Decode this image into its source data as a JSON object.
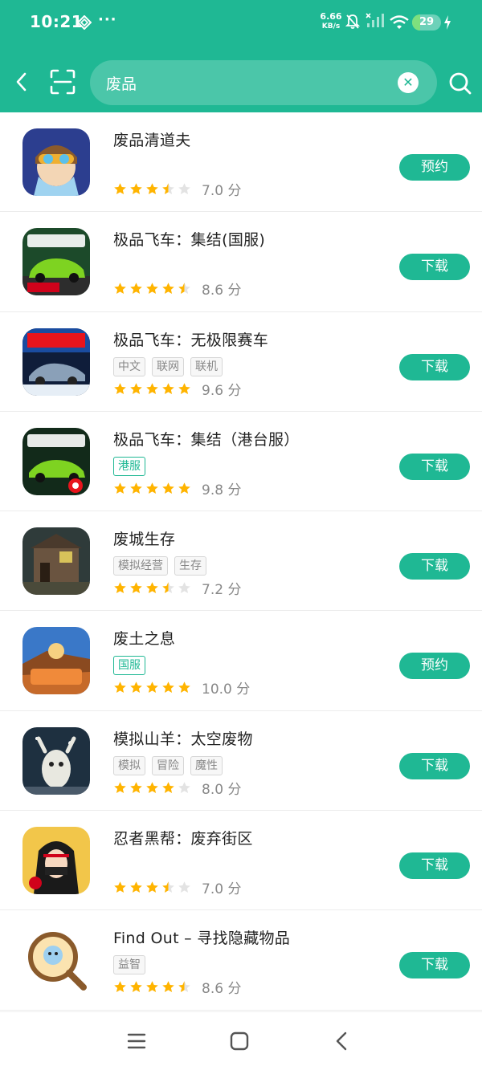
{
  "status_bar": {
    "time": "10:21",
    "dots": "···",
    "net_speed_value": "6.66",
    "net_speed_unit": "KB/s",
    "battery_level": "29",
    "battery_fraction": 0.29,
    "icons": [
      "diamond-app-icon",
      "mute-icon",
      "signal-icon",
      "wifi-icon",
      "battery-icon",
      "charging-icon"
    ]
  },
  "search": {
    "query": "废品",
    "icons": [
      "back-icon",
      "scan-icon",
      "clear-icon",
      "search-icon"
    ]
  },
  "colors": {
    "accent": "#1fb894",
    "star_filled": "#ffb400",
    "star_empty": "#e3e3e3"
  },
  "results": [
    {
      "name": "废品清道夫",
      "tags": [],
      "tag_style": "",
      "rating": 3.5,
      "score": "7.0 分",
      "action": "预约"
    },
    {
      "name": "极品飞车：集结(国服)",
      "tags": [],
      "tag_style": "",
      "rating": 4.5,
      "score": "8.6 分",
      "action": "下载"
    },
    {
      "name": "极品飞车：无极限赛车",
      "tags": [
        "中文",
        "联网",
        "联机"
      ],
      "tag_style": "gray",
      "rating": 5,
      "score": "9.6 分",
      "action": "下载"
    },
    {
      "name": "极品飞车：集结（港台服）",
      "tags": [
        "港服"
      ],
      "tag_style": "green",
      "rating": 5,
      "score": "9.8 分",
      "action": "下载"
    },
    {
      "name": "废城生存",
      "tags": [
        "模拟经营",
        "生存"
      ],
      "tag_style": "gray",
      "rating": 3.5,
      "score": "7.2 分",
      "action": "下载"
    },
    {
      "name": "废土之息",
      "tags": [
        "国服"
      ],
      "tag_style": "green",
      "rating": 5,
      "score": "10.0 分",
      "action": "预约"
    },
    {
      "name": "模拟山羊：太空废物",
      "tags": [
        "模拟",
        "冒险",
        "魔性"
      ],
      "tag_style": "gray",
      "rating": 4,
      "score": "8.0 分",
      "action": "下载"
    },
    {
      "name": "忍者黑帮：废弃街区",
      "tags": [],
      "tag_style": "",
      "rating": 3.5,
      "score": "7.0 分",
      "action": "下载"
    },
    {
      "name": "Find Out – 寻找隐藏物品",
      "tags": [
        "益智"
      ],
      "tag_style": "gray",
      "rating": 4.5,
      "score": "8.6 分",
      "action": "下载"
    }
  ],
  "bottom_nav": {
    "icons": [
      "menu-icon",
      "home-square-icon",
      "back-triangle-icon"
    ]
  }
}
